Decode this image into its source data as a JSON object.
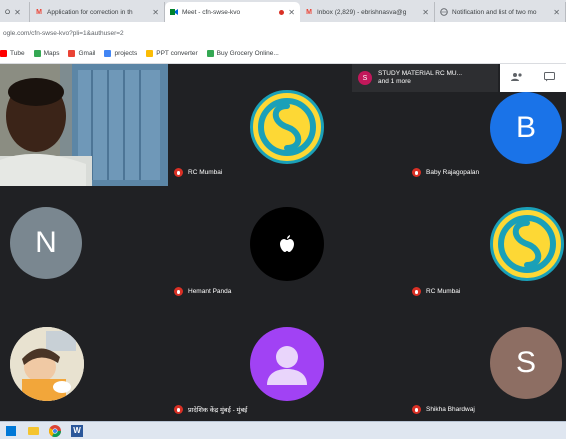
{
  "browser": {
    "tabs": [
      {
        "label": "O",
        "type": "small"
      },
      {
        "label": "Application for correction in th",
        "icon": "gmail-icon"
      },
      {
        "label": "Meet - cfn-swse-kvo",
        "icon": "meet-icon",
        "active": true
      },
      {
        "label": "Inbox (2,829) - ebrishnasva@g",
        "icon": "gmail-icon"
      },
      {
        "label": "Notification and list of two mo",
        "icon": "globe-icon"
      }
    ],
    "address": "ogle.com/cfn-swse-kvo?pli=1&authuser=2",
    "bookmarks": [
      {
        "label": "Tube",
        "color": "#ff0000"
      },
      {
        "label": "Maps",
        "color": "#34a853"
      },
      {
        "label": "Gmail",
        "color": "#ea4335"
      },
      {
        "label": "projects",
        "color": "#4285f4"
      },
      {
        "label": "PPT converter",
        "color": "#fbbc05"
      },
      {
        "label": "Buy Grocery Online...",
        "color": "#34a853"
      }
    ]
  },
  "meet": {
    "presenting": {
      "initial": "S",
      "line1": "STUDY MATERIAL RC MU...",
      "line2": "and 1 more"
    },
    "participants": [
      {
        "name": "",
        "kind": "video"
      },
      {
        "name": "RC Mumbai",
        "kind": "logo"
      },
      {
        "name": "Baby Rajagopalan",
        "kind": "letter",
        "letter": "B",
        "color": "#1a73e8"
      },
      {
        "name": "",
        "kind": "letter",
        "letter": "N",
        "color": "#7a8790"
      },
      {
        "name": "Hemant Panda",
        "kind": "apple"
      },
      {
        "name": "RC Mumbai",
        "kind": "logo"
      },
      {
        "name": "",
        "kind": "photo"
      },
      {
        "name": "प्रादेशिक केंद्र मुंबई - मुंबई",
        "kind": "silhouette",
        "color": "#a142f4"
      },
      {
        "name": "Shikha Bhardwaj",
        "kind": "letter",
        "letter": "S",
        "color": "#8d6e63"
      }
    ]
  },
  "taskbar": {
    "items": [
      "chrome-icon",
      "word-icon"
    ],
    "word_label": "W"
  }
}
